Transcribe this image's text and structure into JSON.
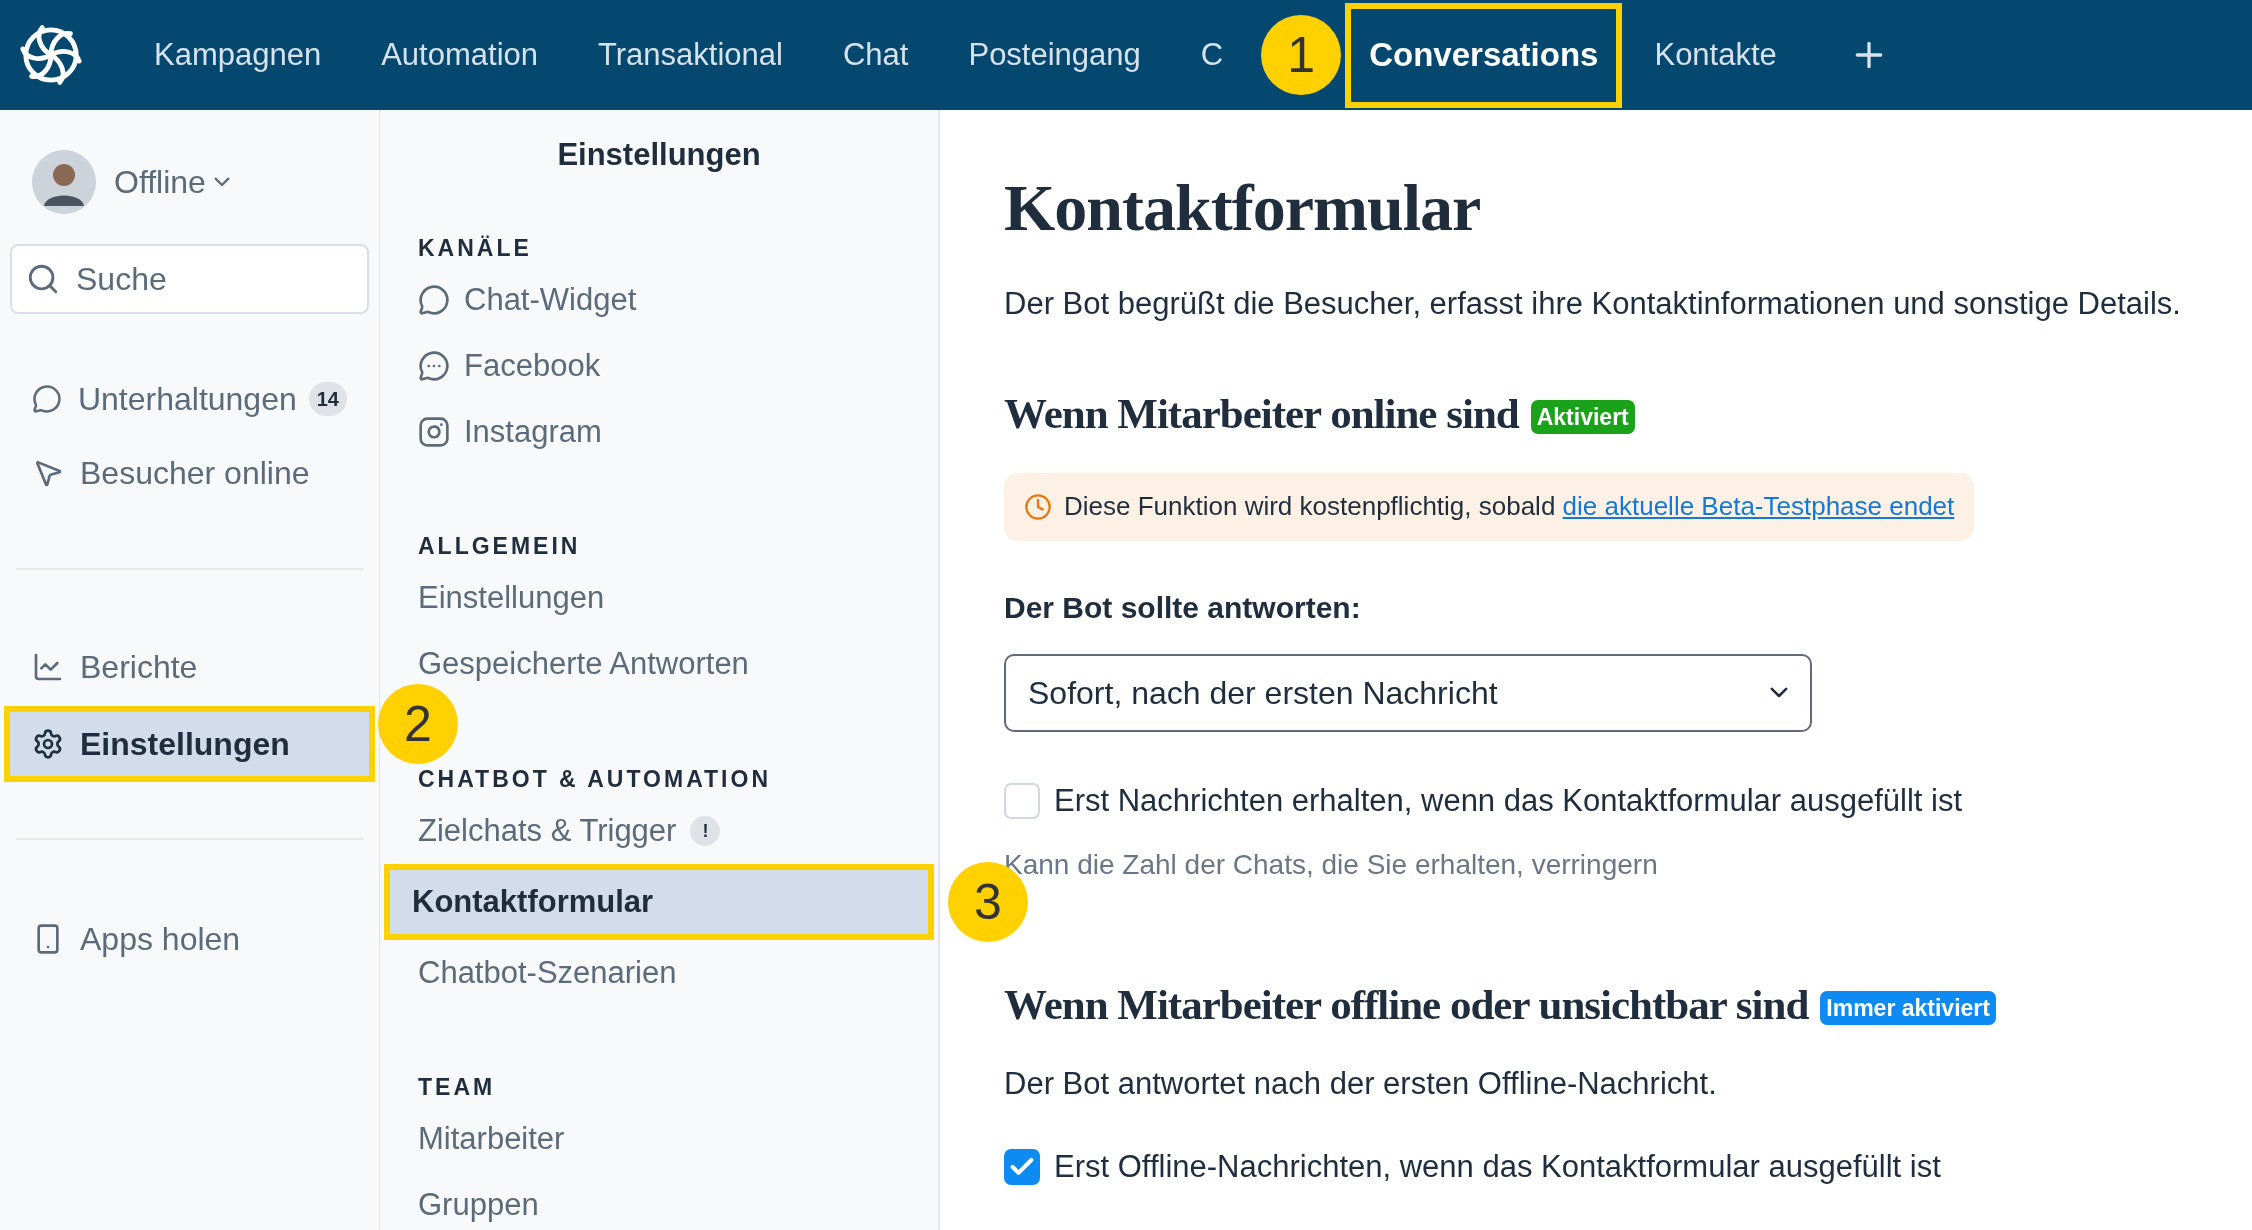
{
  "nav": {
    "items": [
      {
        "label": "Kampagnen",
        "selected": false
      },
      {
        "label": "Automation",
        "selected": false
      },
      {
        "label": "Transaktional",
        "selected": false
      },
      {
        "label": "Chat",
        "selected": false
      },
      {
        "label": "Posteingang",
        "selected": false
      },
      {
        "label": "C",
        "selected": false
      },
      {
        "label": "Conversations",
        "selected": true,
        "callout": "1"
      },
      {
        "label": "Kontakte",
        "selected": false
      }
    ]
  },
  "sidebar": {
    "status": "Offline",
    "search": {
      "placeholder": "Suche"
    },
    "groups": [
      [
        {
          "label": "Unterhaltungen",
          "badge": "14",
          "selected": false
        },
        {
          "label": "Besucher online",
          "selected": false
        }
      ],
      [
        {
          "label": "Berichte",
          "selected": false
        },
        {
          "label": "Einstellungen",
          "selected": true,
          "callout": "2"
        }
      ],
      [
        {
          "label": "Apps holen",
          "selected": false
        }
      ]
    ]
  },
  "settings_nav": {
    "title": "Einstellungen",
    "sections": [
      {
        "heading": "KANÄLE",
        "items": [
          {
            "label": "Chat-Widget",
            "selected": false
          },
          {
            "label": "Facebook",
            "selected": false
          },
          {
            "label": "Instagram",
            "selected": false
          }
        ]
      },
      {
        "heading": "ALLGEMEIN",
        "items": [
          {
            "label": "Einstellungen",
            "selected": false
          },
          {
            "label": "Gespeicherte Antworten",
            "selected": false
          }
        ]
      },
      {
        "heading": "CHATBOT & AUTOMATION",
        "items": [
          {
            "label": "Zielchats & Trigger",
            "badge": "!",
            "selected": false
          },
          {
            "label": "Kontaktformular",
            "selected": true,
            "callout": "3"
          },
          {
            "label": "Chatbot-Szenarien",
            "selected": false
          }
        ]
      },
      {
        "heading": "TEAM",
        "items": [
          {
            "label": "Mitarbeiter",
            "selected": false
          },
          {
            "label": "Gruppen",
            "selected": false
          }
        ]
      }
    ]
  },
  "main": {
    "title": "Kontaktformular",
    "intro": "Der Bot begrüßt die Besucher, erfasst ihre Kontaktinformationen und sonstige Details.",
    "sections": [
      {
        "heading": "Wenn Mitarbeiter online sind",
        "badge": {
          "label": "Aktiviert",
          "color": "#1aa31a"
        },
        "notice": {
          "text": "Diese Funktion wird kostenpflichtig, sobald",
          "link": "die aktuelle Beta-Testphase endet"
        },
        "select": {
          "label": "Der Bot sollte antworten:",
          "value": "Sofort, nach der ersten Nachricht"
        },
        "checkbox": {
          "label": "Erst Nachrichten erhalten, wenn das Kontaktformular ausgefüllt ist",
          "checked": false,
          "hint": "Kann die Zahl der Chats, die Sie erhalten, verringern"
        }
      },
      {
        "heading": "Wenn Mitarbeiter offline oder unsichtbar sind",
        "badge": {
          "label": "Immer aktiviert",
          "color": "#0d8bf2"
        },
        "text": "Der Bot antwortet nach der ersten Offline-Nachricht.",
        "checkbox": {
          "label": "Erst Offline-Nachrichten, wenn das Kontaktformular ausgefüllt ist",
          "checked": true
        }
      }
    ]
  }
}
